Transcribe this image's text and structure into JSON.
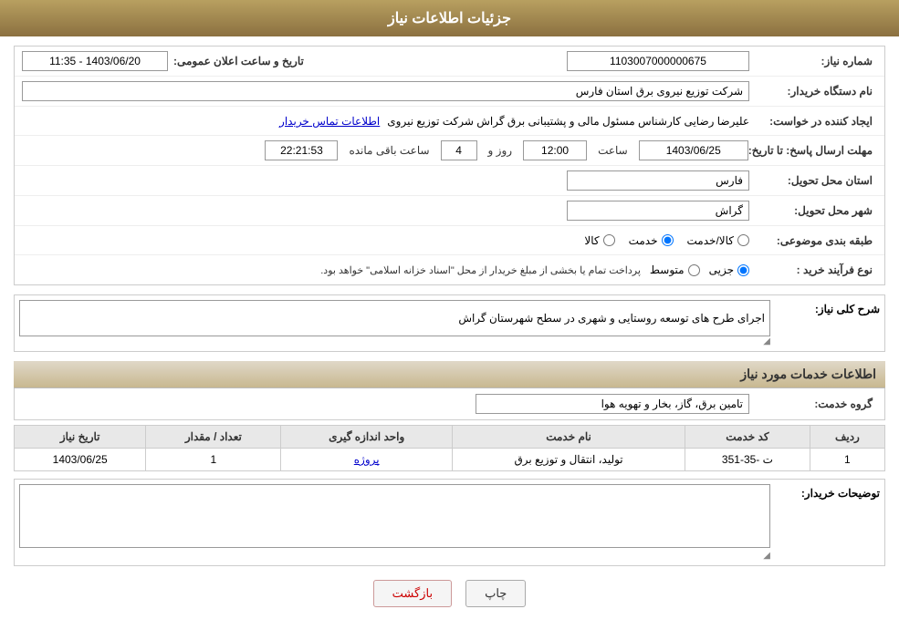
{
  "header": {
    "title": "جزئیات اطلاعات نیاز"
  },
  "fields": {
    "need_number_label": "شماره نیاز:",
    "need_number_value": "1103007000000675",
    "buyer_org_label": "نام دستگاه خریدار:",
    "buyer_org_value": "شرکت توزیع نیروی برق استان فارس",
    "creator_label": "ایجاد کننده در خواست:",
    "creator_value": "علیرضا رضایی کارشناس مسئول مالی و پشتیبانی برق گراش شرکت توزیع نیروی",
    "creator_link": "اطلاعات تماس خریدار",
    "deadline_label": "مهلت ارسال پاسخ: تا تاریخ:",
    "deadline_date": "1403/06/25",
    "deadline_time_label": "ساعت",
    "deadline_time": "12:00",
    "deadline_day_label": "روز و",
    "deadline_days": "4",
    "deadline_remaining_label": "ساعت باقی مانده",
    "deadline_remaining": "22:21:53",
    "province_label": "استان محل تحویل:",
    "province_value": "فارس",
    "city_label": "شهر محل تحویل:",
    "city_value": "گراش",
    "category_label": "طبقه بندی موضوعی:",
    "category_kala": "کالا",
    "category_khadamat": "خدمت",
    "category_kala_khadamat": "کالا/خدمت",
    "category_selected": "khadamat",
    "process_label": "نوع فرآیند خرید :",
    "process_jazzi": "جزیی",
    "process_mottasat": "متوسط",
    "process_text": "پرداخت تمام یا بخشی از مبلغ خریدار از محل \"اسناد خزانه اسلامی\" خواهد بود.",
    "description_section_label": "شرح کلی نیاز:",
    "description_value": "اجرای طرح های توسعه روستایی و شهری در سطح شهرستان گراش",
    "services_title": "اطلاعات خدمات مورد نیاز",
    "service_group_label": "گروه خدمت:",
    "service_group_value": "تامین برق، گاز، بخار و تهویه هوا",
    "table_headers": {
      "row_num": "ردیف",
      "service_code": "کد خدمت",
      "service_name": "نام خدمت",
      "unit": "واحد اندازه گیری",
      "quantity": "تعداد / مقدار",
      "date": "تاریخ نیاز"
    },
    "table_rows": [
      {
        "row_num": "1",
        "service_code": "ت -35-351",
        "service_name": "تولید، انتقال و توزیع برق",
        "unit": "پروژه",
        "quantity": "1",
        "date": "1403/06/25"
      }
    ],
    "buyer_notes_label": "توضیحات خریدار:",
    "buyer_notes_value": "",
    "publish_datetime_label": "تاریخ و ساعت اعلان عمومی:",
    "publish_datetime": "1403/06/20 - 11:35"
  },
  "buttons": {
    "print": "چاپ",
    "back": "بازگشت"
  }
}
